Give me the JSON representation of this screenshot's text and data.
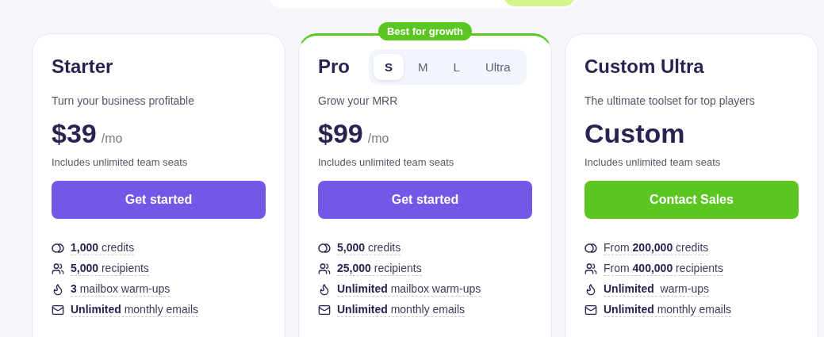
{
  "plans": [
    {
      "name": "Starter",
      "tagline": "Turn your business profitable",
      "price": "$39",
      "period": "/mo",
      "seats": "Includes unlimited team seats",
      "cta": {
        "label": "Get started",
        "kind": "primary"
      },
      "highlighted": false,
      "features": [
        {
          "kind": "credits",
          "text": "**1,000** credits"
        },
        {
          "kind": "recipients",
          "text": "**5,000** recipients"
        },
        {
          "kind": "warmup",
          "text": "**3** mailbox warm-ups"
        },
        {
          "kind": "emails",
          "text": "**Unlimited** monthly emails"
        }
      ]
    },
    {
      "name": "Pro",
      "badge": "Best for growth",
      "sizes": [
        {
          "label": "S",
          "selected": true
        },
        {
          "label": "M",
          "selected": false
        },
        {
          "label": "L",
          "selected": false
        },
        {
          "label": "Ultra",
          "selected": false
        }
      ],
      "tagline": "Grow your MRR",
      "price": "$99",
      "period": "/mo",
      "seats": "Includes unlimited team seats",
      "cta": {
        "label": "Get started",
        "kind": "primary"
      },
      "highlighted": true,
      "features": [
        {
          "kind": "credits",
          "text": "**5,000** credits"
        },
        {
          "kind": "recipients",
          "text": "**25,000** recipients"
        },
        {
          "kind": "warmup",
          "text": "**Unlimited** mailbox warm-ups"
        },
        {
          "kind": "emails",
          "text": "**Unlimited** monthly emails"
        }
      ]
    },
    {
      "name": "Custom Ultra",
      "tagline": "The ultimate toolset for top players",
      "price": "Custom",
      "seats": "Includes unlimited team seats",
      "cta": {
        "label": "Contact Sales",
        "kind": "sales"
      },
      "highlighted": false,
      "features": [
        {
          "kind": "credits",
          "text": "From **200,000** credits"
        },
        {
          "kind": "recipients",
          "text": "From **400,000** recipients"
        },
        {
          "kind": "warmup",
          "text": "**Unlimited**  warm-ups"
        },
        {
          "kind": "emails",
          "text": "**Unlimited** monthly emails"
        }
      ]
    }
  ]
}
